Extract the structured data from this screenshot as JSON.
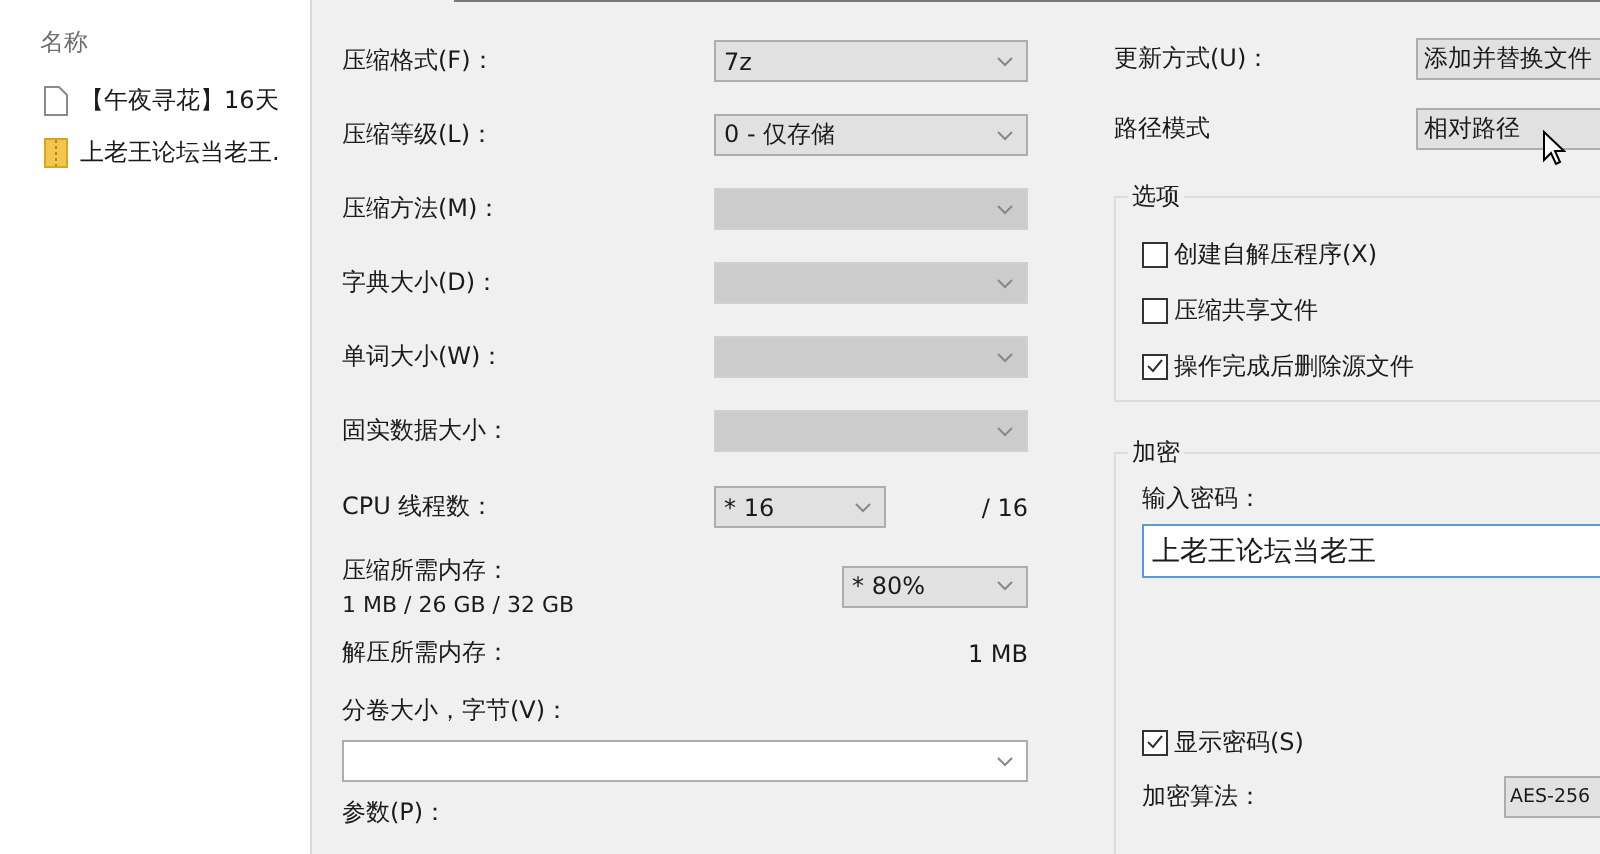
{
  "explorer": {
    "header": "名称",
    "files": [
      {
        "name": "【午夜寻花】16天",
        "kind": "document"
      },
      {
        "name": "上老王论坛当老王.",
        "kind": "archive"
      }
    ]
  },
  "left_rows": [
    {
      "kind": "select",
      "label": "压缩格式(F)：",
      "value": "7z",
      "disabled": false
    },
    {
      "kind": "select",
      "label": "压缩等级(L)：",
      "value": "0 - 仅存储",
      "disabled": false
    },
    {
      "kind": "select",
      "label": "压缩方法(M)：",
      "disabled": true
    },
    {
      "kind": "select",
      "label": "字典大小(D)：",
      "disabled": true
    },
    {
      "kind": "select",
      "label": "单词大小(W)：",
      "disabled": true
    },
    {
      "kind": "select",
      "label": "固实数据大小：",
      "disabled": true
    },
    {
      "kind": "threads",
      "label": "CPU 线程数：",
      "value": "* 16",
      "total": "/ 16"
    },
    {
      "kind": "memory",
      "label": "压缩所需内存：",
      "detail": "1 MB / 26 GB / 32 GB",
      "value": "* 80%"
    },
    {
      "kind": "info",
      "label": "解压所需内存：",
      "value": "1 MB"
    },
    {
      "kind": "volume",
      "label": "分卷大小，字节(V)："
    },
    {
      "kind": "label",
      "label": "参数(P)："
    }
  ],
  "update": {
    "label": "更新方式(U)：",
    "value": "添加并替换文件"
  },
  "path": {
    "label": "路径模式",
    "value": "相对路径"
  },
  "options": {
    "title": "选项",
    "items": [
      {
        "label": "创建自解压程序(X)",
        "checked": false
      },
      {
        "label": "压缩共享文件",
        "checked": false
      },
      {
        "label": "操作完成后删除源文件",
        "checked": true
      }
    ]
  },
  "encryption": {
    "title": "加密",
    "password_label": "输入密码：",
    "password": "上老王论坛当老王",
    "show_password": {
      "label": "显示密码(S)",
      "checked": true
    },
    "method_label": "加密算法：",
    "method": "AES-256"
  }
}
